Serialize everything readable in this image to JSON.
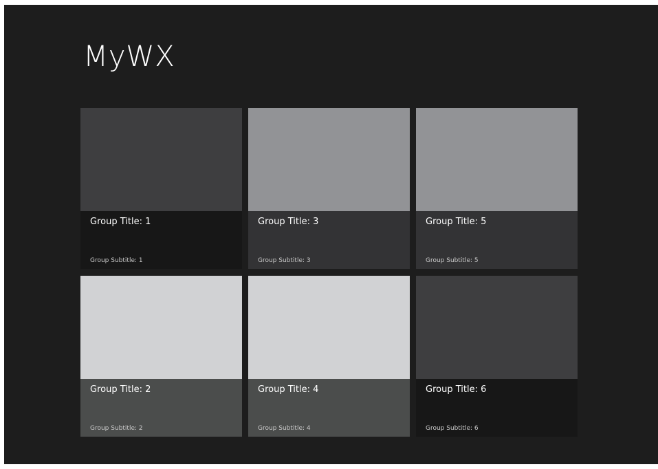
{
  "app": {
    "title": "MyWX",
    "background": "#1d1d1d"
  },
  "groups": [
    {
      "title": "Group Title: 1",
      "subtitle": "Group Subtitle: 1",
      "image_color": "#3e3e40",
      "caption_color": "#171717"
    },
    {
      "title": "Group Title: 2",
      "subtitle": "Group Subtitle: 2",
      "image_color": "#d1d2d4",
      "caption_color": "#4b4d4c"
    },
    {
      "title": "Group Title: 3",
      "subtitle": "Group Subtitle: 3",
      "image_color": "#929396",
      "caption_color": "#333335"
    },
    {
      "title": "Group Title: 4",
      "subtitle": "Group Subtitle: 4",
      "image_color": "#d1d2d4",
      "caption_color": "#4b4d4c"
    },
    {
      "title": "Group Title: 5",
      "subtitle": "Group Subtitle: 5",
      "image_color": "#929396",
      "caption_color": "#333335"
    },
    {
      "title": "Group Title: 6",
      "subtitle": "Group Subtitle: 6",
      "image_color": "#3e3e40",
      "caption_color": "#171717"
    }
  ]
}
